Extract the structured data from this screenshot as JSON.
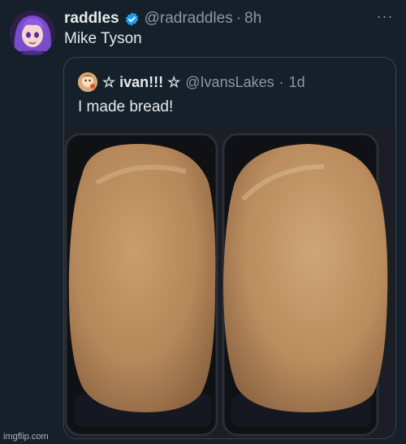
{
  "tweet": {
    "display_name": "raddles",
    "handle": "@radraddles",
    "time": "8h",
    "separator": "·",
    "text": "Mike Tyson",
    "more_label": "···",
    "verified_color": "#1d9bf0",
    "avatar_icon": "anime-character-avatar"
  },
  "quoted": {
    "display_name": "☆ ivan!!! ☆",
    "handle": "@IvansLakes",
    "time": "1d",
    "separator": "·",
    "text": "I made bread!",
    "avatar_icon": "profile-avatar",
    "photo_subject": "two loaves of bread in baking pans"
  },
  "watermark": "imgflip.com",
  "colors": {
    "background": "#15202b",
    "text": "#e7e9ea",
    "muted": "#8b98a5",
    "border": "#38444d"
  }
}
